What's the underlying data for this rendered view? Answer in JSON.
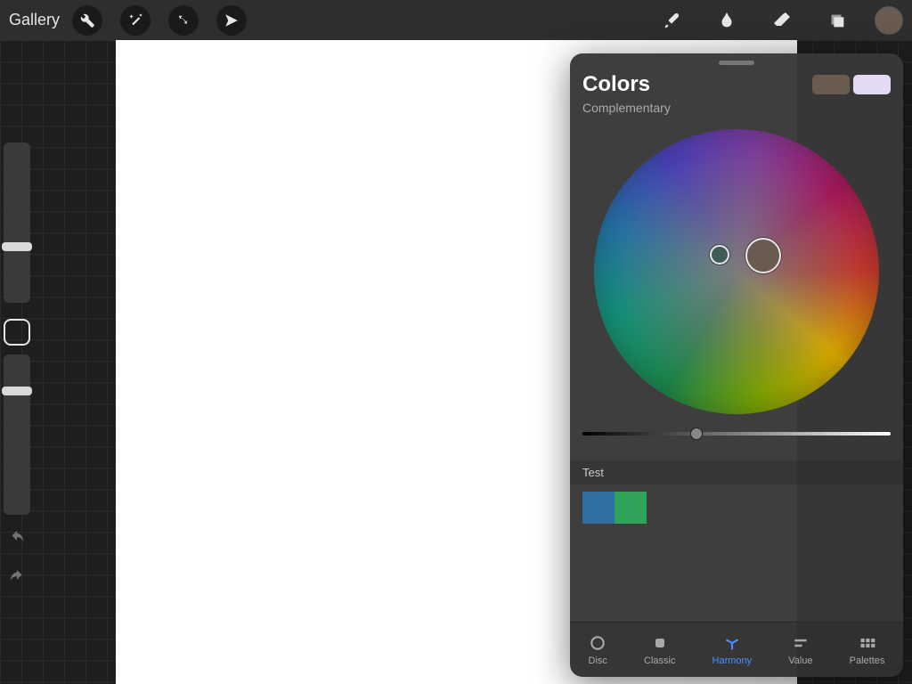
{
  "topbar": {
    "gallery_label": "Gallery",
    "left_icons": [
      "wrench",
      "wand",
      "select",
      "share"
    ],
    "right_icons": [
      "brush",
      "smudge",
      "eraser",
      "layers"
    ]
  },
  "current_color": "#6a5b51",
  "left_sliders": {
    "brush_size_pct": 62,
    "opacity_pct": 20
  },
  "colors_panel": {
    "title": "Colors",
    "mode": "Complementary",
    "primary_swatch": "#6a5b51",
    "secondary_swatch": "#e5daf4",
    "picker_main": "#6a5b51",
    "picker_comp": "#3f5c57",
    "lightness_pct": 35,
    "palette_name": "Test",
    "palette_colors": [
      "#2f6fa3",
      "#2fa35a"
    ],
    "tabs": [
      {
        "id": "disc",
        "label": "Disc"
      },
      {
        "id": "classic",
        "label": "Classic"
      },
      {
        "id": "harmony",
        "label": "Harmony"
      },
      {
        "id": "value",
        "label": "Value"
      },
      {
        "id": "palettes",
        "label": "Palettes"
      }
    ],
    "active_tab": "harmony"
  }
}
